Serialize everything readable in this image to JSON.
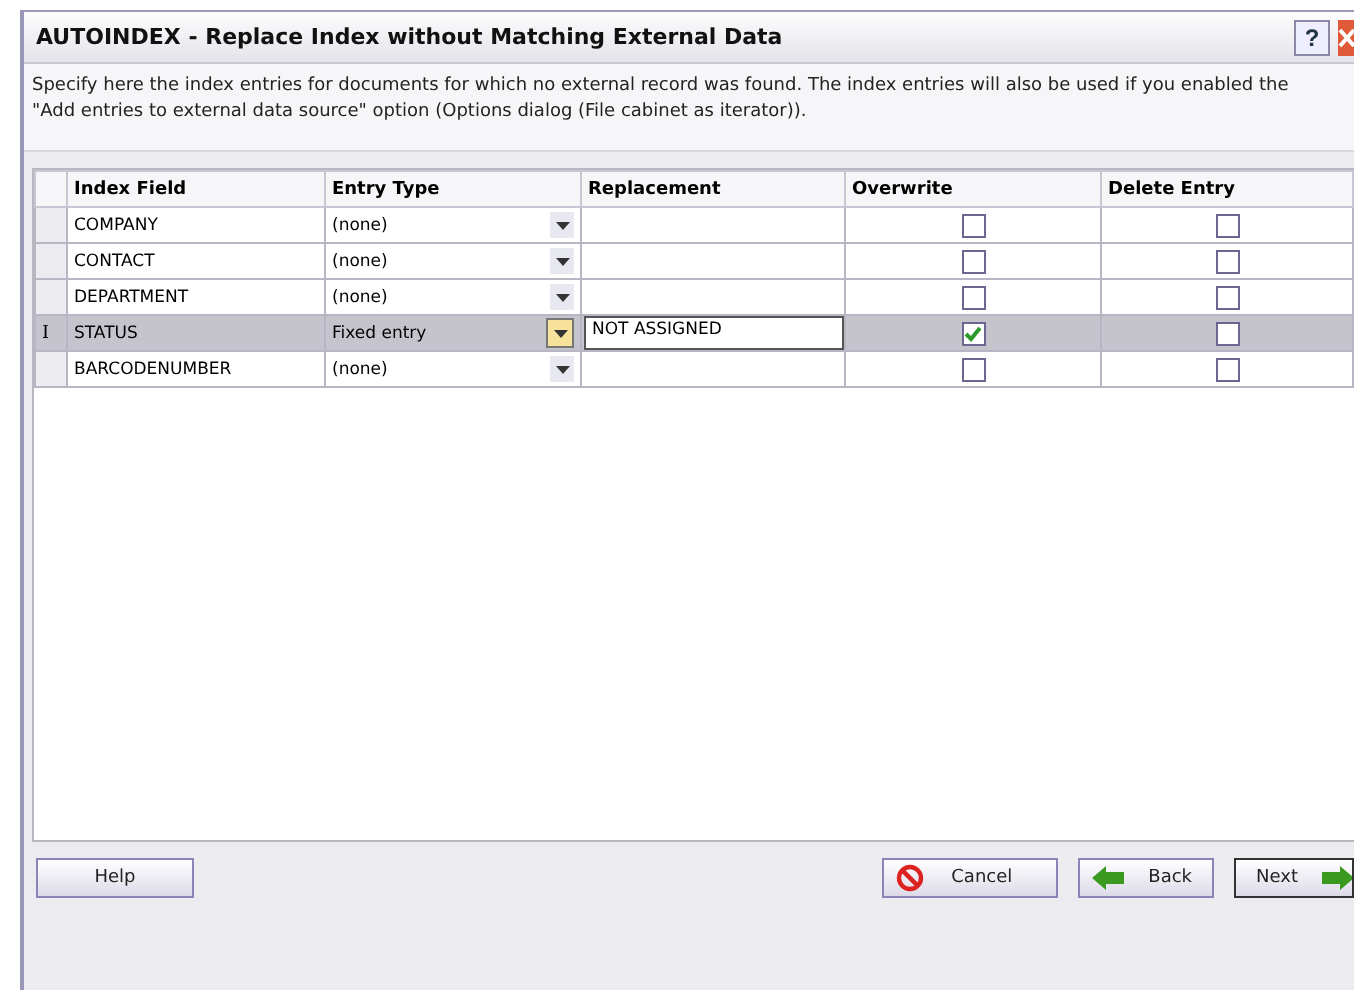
{
  "window": {
    "title": "AUTOINDEX - Replace Index without Matching External Data",
    "help_glyph": "?"
  },
  "description": "Specify here the index entries for documents for which no external record was found. The index entries will also be used if you enabled the \"Add entries to external data source\" option (Options dialog (File cabinet as iterator)).",
  "table": {
    "columns": [
      "Index Field",
      "Entry Type",
      "Replacement",
      "Overwrite",
      "Delete Entry"
    ],
    "rows": [
      {
        "field": "COMPANY",
        "entry_type": "(none)",
        "overwrite": false,
        "delete": false,
        "selected": false
      },
      {
        "field": "CONTACT",
        "entry_type": "(none)",
        "overwrite": false,
        "delete": false,
        "selected": false
      },
      {
        "field": "DEPARTMENT",
        "entry_type": "(none)",
        "overwrite": false,
        "delete": false,
        "selected": false
      },
      {
        "field": "STATUS",
        "entry_type": "Fixed entry",
        "replacement": "NOT ASSIGNED",
        "overwrite": true,
        "delete": false,
        "selected": true,
        "row_marker": "I"
      },
      {
        "field": "BARCODENUMBER",
        "entry_type": "(none)",
        "overwrite": false,
        "delete": false,
        "selected": false
      }
    ]
  },
  "buttons": {
    "help": "Help",
    "cancel": "Cancel",
    "back": "Back",
    "next": "Next"
  }
}
